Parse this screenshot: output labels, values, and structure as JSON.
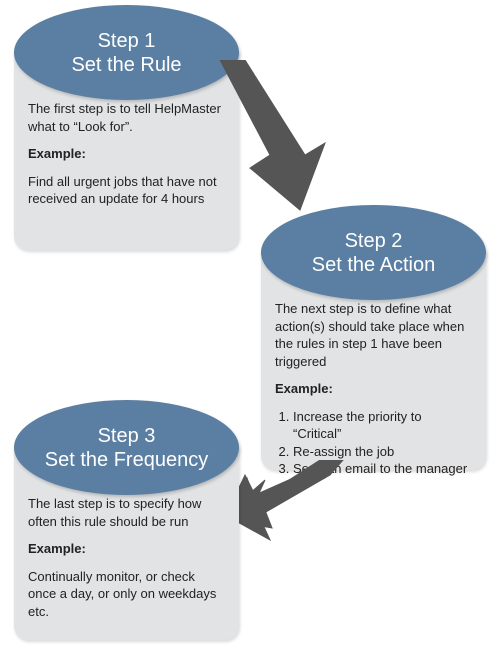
{
  "steps": [
    {
      "step_line": "Step 1",
      "title": "Set the Rule",
      "intro": "The first step is to tell HelpMaster what to “Look for”.",
      "example_label": "Example:",
      "example_text": "Find all urgent jobs that have not received an update for 4 hours"
    },
    {
      "step_line": "Step 2",
      "title": "Set the Action",
      "intro": "The next step is to define what action(s) should take place when the rules in step 1 have been triggered",
      "example_label": "Example:",
      "example_list": [
        "Increase the priority to “Critical”",
        "Re-assign the job",
        "Send an email to the manager"
      ]
    },
    {
      "step_line": "Step 3",
      "title": "Set the Frequency",
      "intro": "The last step is to specify how often this rule should be run",
      "example_label": "Example:",
      "example_text": "Continually monitor, or check once a day, or only on weekdays etc."
    }
  ]
}
